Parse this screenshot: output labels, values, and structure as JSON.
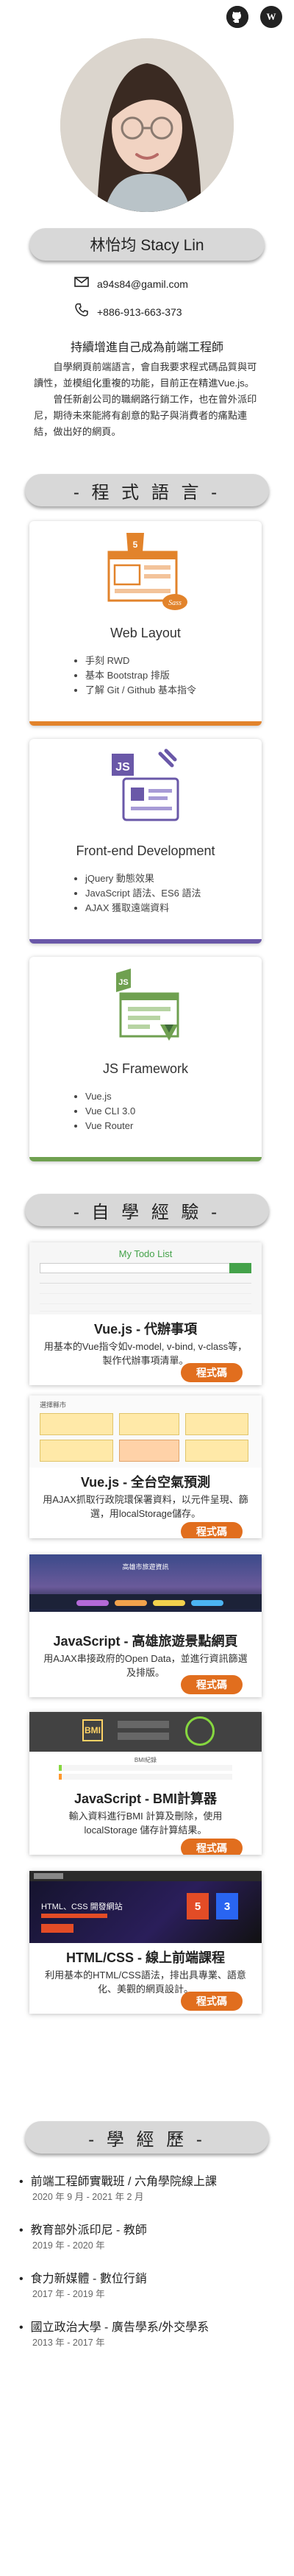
{
  "header_icons": [
    {
      "name": "github-icon"
    },
    {
      "name": "wordpress-icon",
      "glyph": "W"
    }
  ],
  "profile": {
    "name": "林怡均 Stacy Lin",
    "email": "a94s84@gamil.com",
    "phone": "+886-913-663-373",
    "motto": "持續增進自己成為前端工程師",
    "intro": [
      "自學網頁前端語言，會自我要求程式碼品質與可讀性，並模組化重複的功能，目前正在精進Vue.js。",
      "曾任新創公司的職網路行銷工作，也在曾外派印尼，期待未來能將有創意的點子與消費者的痛點連結，做出好的網頁。"
    ]
  },
  "sections": {
    "skills": "- 程 式 語 言 -",
    "works": "- 自 學 經 驗 -",
    "education": "- 學 經 歷 -"
  },
  "skills": [
    {
      "title": "Web Layout",
      "items": [
        "手刻 RWD",
        "基本 Bootstrap 排版",
        "了解 Git / Github 基本指令"
      ],
      "color": "#e2832b"
    },
    {
      "title": "Front-end Development",
      "items": [
        "jQuery 動態效果",
        "JavaScript 語法、ES6 語法",
        "AJAX 獲取遠端資料"
      ],
      "color": "#6a58a8"
    },
    {
      "title": "JS Framework",
      "items": [
        "Vue.js",
        "Vue CLI 3.0",
        "Vue Router"
      ],
      "color": "#6fa050"
    }
  ],
  "works": [
    {
      "title": "Vue.js - 代辦事項",
      "desc": "用基本的Vue指令如v-model, v-bind, v-class等，製作代辦事項清單。",
      "button": "程式碼",
      "shot_title": "My Todo List"
    },
    {
      "title": "Vue.js - 全台空氣預測",
      "desc": "用AJAX抓取行政院環保署資料，以元件呈現、篩選，用localStorage儲存。",
      "button": "程式碼",
      "shot_title": "選擇縣市"
    },
    {
      "title": "JavaScript - 高雄旅遊景點網頁",
      "desc": "用AJAX串接政府的Open Data，並進行資訊篩選及排版。",
      "button": "程式碼",
      "shot_title": "高雄市旅遊資訊"
    },
    {
      "title": "JavaScript - BMI計算器",
      "desc": "輸入資料進行BMI 計算及刪除，使用 localStorage 儲存計算結果。",
      "button": "程式碼",
      "shot_title": "BMI紀錄"
    },
    {
      "title": "HTML/CSS - 線上前端課程",
      "desc": "利用基本的HTML/CSS語法，排出具專業、語意化、美觀的網頁設計。",
      "button": "程式碼",
      "shot_title": "HTML、CSS 開發網站"
    }
  ],
  "education": [
    {
      "school": "前端工程師實戰班 / 六角學院線上課",
      "date": "2020 年 9 月 - 2021 年 2 月"
    },
    {
      "school": "教育部外派印尼 - 教師",
      "date": "2019 年 - 2020 年"
    },
    {
      "school": "食力新媒體 - 數位行銷",
      "date": "2017 年 - 2019 年"
    },
    {
      "school": "國立政治大學 - 廣告學系/外交學系",
      "date": "2013 年 - 2017 年"
    }
  ]
}
